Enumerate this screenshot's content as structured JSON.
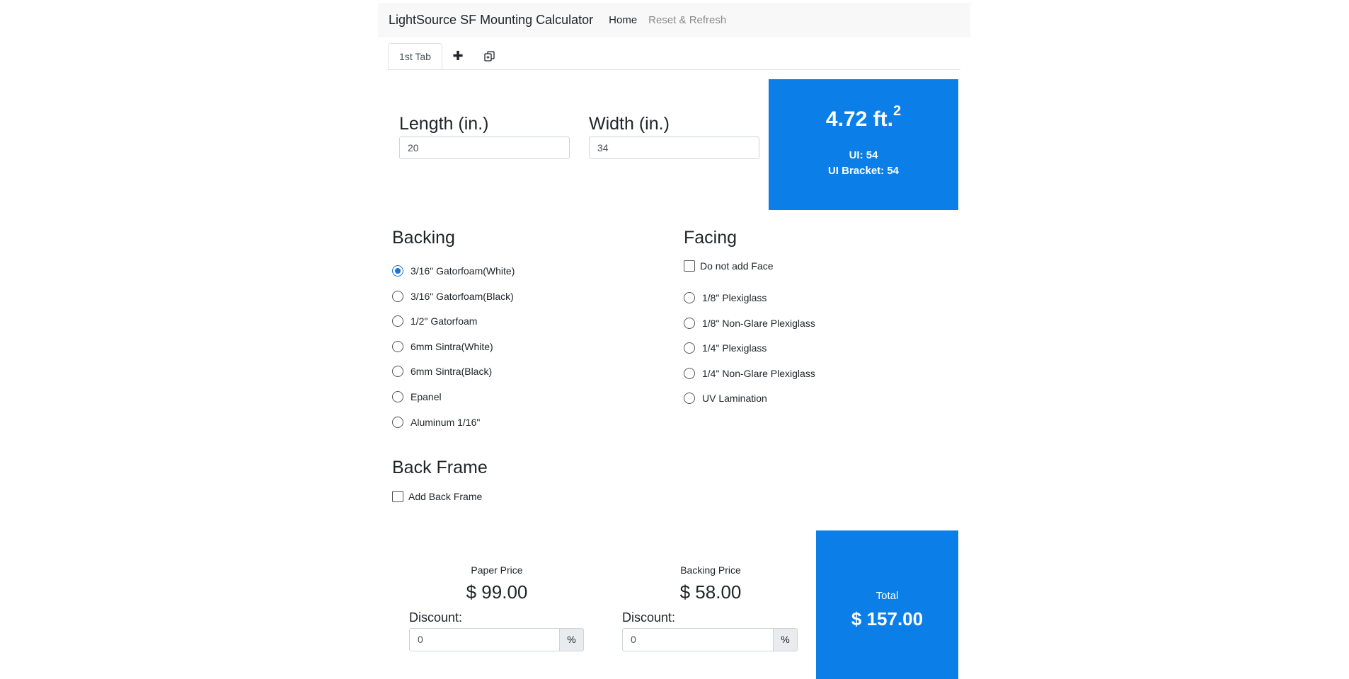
{
  "navbar": {
    "brand": "LightSource SF Mounting Calculator",
    "home_label": "Home",
    "reset_label": "Reset & Refresh"
  },
  "tabs": {
    "active_label": "1st Tab",
    "add_symbol": "✚",
    "duplicate_icon": "duplicate-icon"
  },
  "dimensions": {
    "length_label": "Length (in.)",
    "length_value": "20",
    "width_label": "Width (in.)",
    "width_value": "34"
  },
  "area": {
    "value": "4.72 ft.",
    "superscript": "2",
    "ui": "UI: 54",
    "ui_bracket": "UI Bracket: 54"
  },
  "backing": {
    "heading": "Backing",
    "options": [
      "3/16\" Gatorfoam(White)",
      "3/16\" Gatorfoam(Black)",
      "1/2\" Gatorfoam",
      "6mm Sintra(White)",
      "6mm Sintra(Black)",
      "Epanel",
      "Aluminum 1/16\""
    ],
    "selected_index": 0
  },
  "facing": {
    "heading": "Facing",
    "no_face_label": "Do not add Face",
    "options": [
      "1/8\" Plexiglass",
      "1/8\" Non-Glare Plexiglass",
      "1/4\" Plexiglass",
      "1/4\" Non-Glare Plexiglass",
      "UV Lamination"
    ]
  },
  "back_frame": {
    "heading": "Back Frame",
    "checkbox_label": "Add Back Frame"
  },
  "pricing": {
    "paper_label": "Paper Price",
    "paper_value": "$ 99.00",
    "backing_label": "Backing Price",
    "backing_value": "$ 58.00",
    "discount_label": "Discount:",
    "paper_discount": "0",
    "backing_discount": "0",
    "percent": "%",
    "total_label": "Total",
    "total_value": "$ 157.00"
  },
  "colors": {
    "accent": "#0b7fe7",
    "navbar_bg": "#f8f8f8",
    "radio_selected": "#1a73d9"
  }
}
